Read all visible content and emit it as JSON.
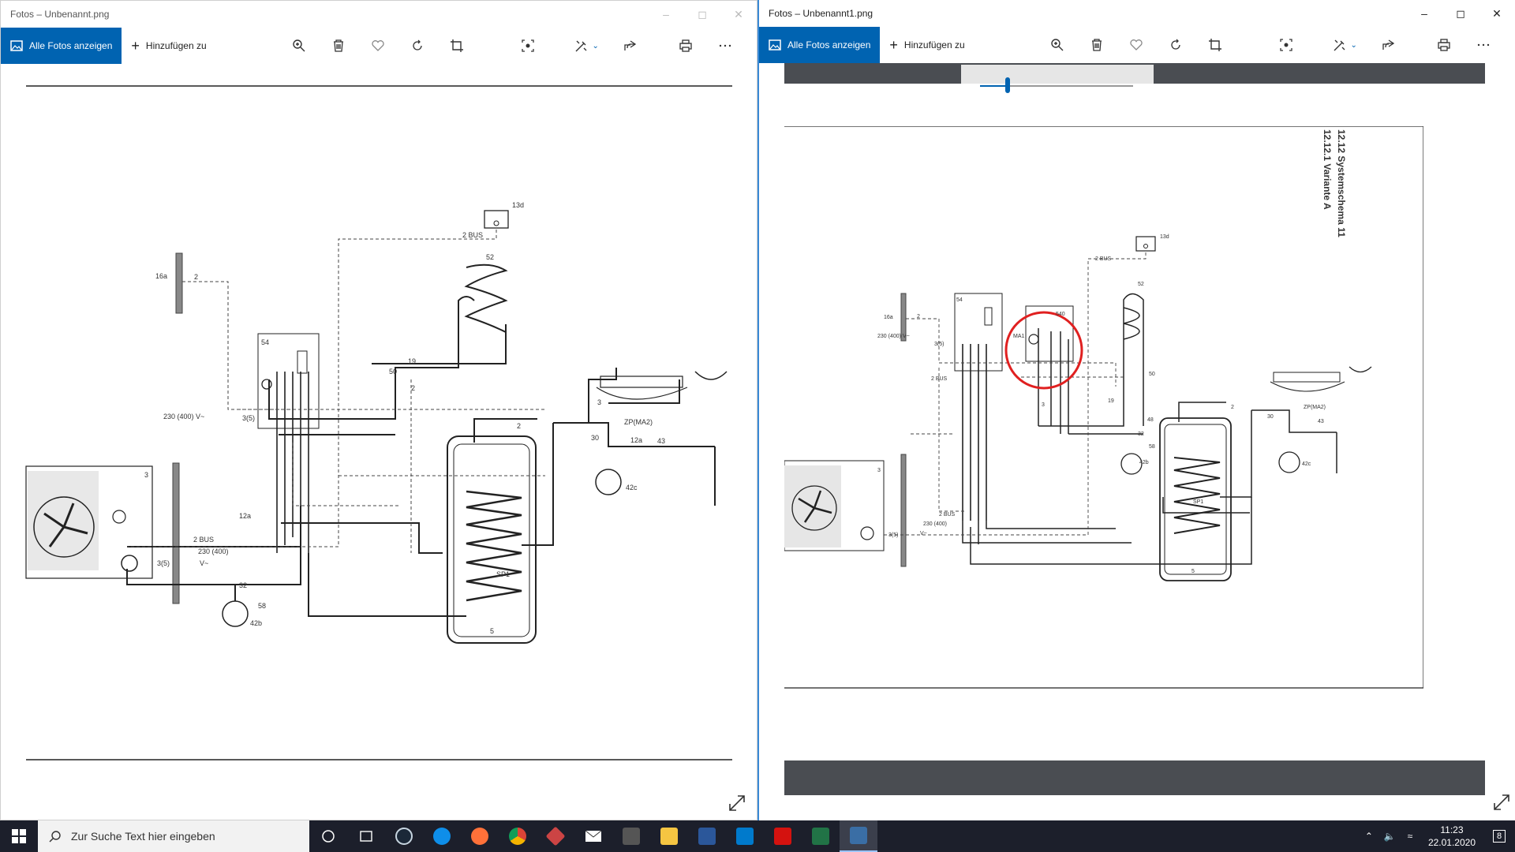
{
  "left_window": {
    "title": "Fotos – Unbenannt.png",
    "toolbar": {
      "all_photos_label": "Alle Fotos anzeigen",
      "add_to_label": "Hinzufügen zu"
    }
  },
  "right_window": {
    "title": "Fotos – Unbenannt1.png",
    "toolbar": {
      "all_photos_label": "Alle Fotos anzeigen",
      "add_to_label": "Hinzufügen zu"
    },
    "page_heading_1": "12.12   Systemschema 11",
    "page_heading_2": "12.12.1 Variante A"
  },
  "diagram_labels_left": {
    "l13d": "13d",
    "l2bus_top": "2 BUS",
    "l52": "52",
    "l16a": "16a",
    "l2a": "2",
    "l54": "54",
    "l19": "19",
    "l50": "50",
    "l2b": "2",
    "l230": "230 (400) V~",
    "l35a": "3(5)",
    "l3": "3",
    "l2c": "2",
    "l30": "30",
    "lzp": "ZP(MA2)",
    "l12a": "12a",
    "l43": "43",
    "l42c": "42c",
    "l3b": "3",
    "l12a2": "12a",
    "l2bus_bot": "2 BUS",
    "l230b": "230 (400)",
    "l35b": "3(5)",
    "lv": "V~",
    "l32": "32",
    "l58": "58",
    "l42b": "42b",
    "lsp1": "SP1",
    "l5": "5"
  },
  "diagram_labels_right": {
    "l13d": "13d",
    "l2bus": "2 BUS",
    "l52": "52",
    "l54": "54",
    "l16a": "16a",
    "l2": "2",
    "l540": "540",
    "lma": "MA1",
    "l230": "230 (400) V~",
    "l35": "3(5)",
    "l2bus2": "2 BUS",
    "l50": "50",
    "l19": "19",
    "l48": "48",
    "l32": "32",
    "l58": "58",
    "l42b": "42b",
    "l3": "3",
    "l2b": "2",
    "l30": "30",
    "lzp": "ZP(MA2)",
    "l43": "43",
    "l42c": "42c",
    "l3b": "3",
    "l2bus3": "2 BUS",
    "l230b": "230 (400)",
    "lv": "V~",
    "l35b": "3(5)",
    "lsp1": "SP1",
    "l5": "5"
  },
  "taskbar": {
    "search_placeholder": "Zur Suche Text hier eingeben",
    "time": "11:23",
    "date": "22.01.2020",
    "notification_count": "8"
  },
  "colors": {
    "accent": "#0063b1",
    "highlight_circle": "#e02020",
    "taskbar": "#1c1f2b"
  },
  "icons": [
    "zoom-icon",
    "delete-icon",
    "heart-icon",
    "rotate-icon",
    "crop-icon",
    "enhance-icon",
    "edit-icon",
    "share-icon",
    "print-icon",
    "more-icon"
  ]
}
